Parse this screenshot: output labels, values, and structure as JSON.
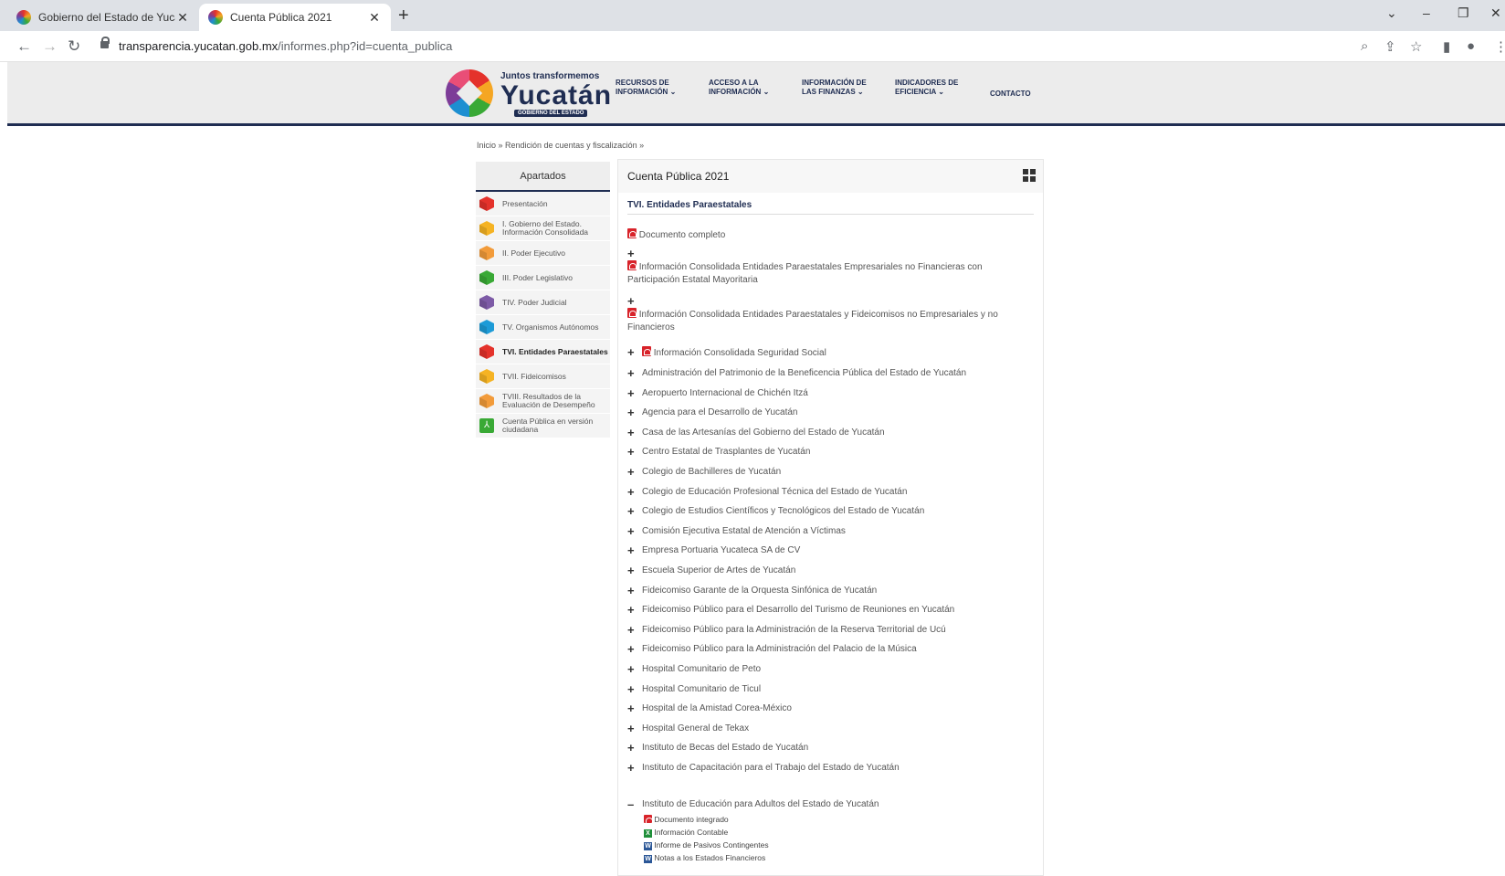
{
  "browser": {
    "tabs": [
      {
        "title": "Gobierno del Estado de Yucatán"
      },
      {
        "title": "Cuenta Pública 2021"
      }
    ],
    "url_host": "transparencia.yucatan.gob.mx",
    "url_path": "/informes.php?id=cuenta_publica"
  },
  "site": {
    "logo_tagline": "Juntos transformemos",
    "logo_name": "Yucatán",
    "logo_gov": "GOBIERNO DEL ESTADO",
    "menu": [
      {
        "line1": "RECURSOS DE",
        "line2": "INFORMACIÓN"
      },
      {
        "line1": "ACCESO A LA",
        "line2": "INFORMACIÓN"
      },
      {
        "line1": "INFORMACIÓN DE",
        "line2": "LAS FINANZAS"
      },
      {
        "line1": "INDICADORES DE",
        "line2": "EFICIENCIA"
      },
      {
        "line1": "CONTACTO",
        "line2": ""
      }
    ]
  },
  "breadcrumb": "Inicio » Rendición de cuentas y fiscalización »",
  "sidebar": {
    "heading": "Apartados",
    "items": [
      {
        "label": "Presentación",
        "color": "#e4322b"
      },
      {
        "label": "I. Gobierno del Estado. Información Consolidada",
        "color": "#f5b323"
      },
      {
        "label": "II. Poder Ejecutivo",
        "color": "#f29b3a"
      },
      {
        "label": "III. Poder Legislativo",
        "color": "#39a935"
      },
      {
        "label": "TIV. Poder Judicial",
        "color": "#7d5ba6"
      },
      {
        "label": "TV. Organismos Autónomos",
        "color": "#1d9bd7"
      },
      {
        "label": "TVI. Entidades Paraestatales",
        "color": "#e4322b"
      },
      {
        "label": "TVII. Fideicomisos",
        "color": "#f5b323"
      },
      {
        "label": "TVIII. Resultados de la Evaluación de Desempeño",
        "color": "#f29b3a"
      },
      {
        "label": "Cuenta Pública en versión ciudadana",
        "color": "#39a935"
      }
    ]
  },
  "panel": {
    "title": "Cuenta Pública 2021",
    "section": "TVI. Entidades Paraestatales",
    "doc_complete": "Documento completo",
    "cons1": "Información Consolidada Entidades Paraestatales Empresariales no Financieras con Participación Estatal Mayoritaria",
    "cons2": "Información Consolidada Entidades Paraestatales y Fideicomisos no Empresariales y no Financieros",
    "cons3": "Información Consolidada Seguridad Social",
    "entities": [
      "Administración del Patrimonio de la Beneficencia Pública del Estado de Yucatán",
      "Aeropuerto Internacional de Chichén Itzá",
      "Agencia para el Desarrollo de Yucatán",
      "Casa de las Artesanías del Gobierno del Estado de Yucatán",
      "Centro Estatal de Trasplantes de Yucatán",
      "Colegio de Bachilleres de Yucatán",
      "Colegio de Educación Profesional Técnica del Estado de Yucatán",
      "Colegio de Estudios Científicos y Tecnológicos del Estado de Yucatán",
      "Comisión Ejecutiva Estatal de Atención a Víctimas",
      "Empresa Portuaria Yucateca SA de CV",
      "Escuela Superior de Artes de Yucatán",
      "Fideicomiso Garante de la Orquesta Sinfónica de Yucatán",
      "Fideicomiso Público para el Desarrollo del Turismo de Reuniones en Yucatán",
      "Fideicomiso Público para la Administración de la Reserva Territorial de Ucú",
      "Fideicomiso Público para la Administración del Palacio de la Música",
      "Hospital Comunitario de Peto",
      "Hospital Comunitario de Ticul",
      "Hospital de la Amistad Corea-México",
      "Hospital General de Tekax",
      "Instituto de Becas del Estado de Yucatán",
      "Instituto de Capacitación para el Trabajo del Estado de Yucatán"
    ],
    "expanded": "Instituto de Educación para Adultos del Estado de Yucatán",
    "expanded_docs": [
      {
        "label": "Documento integrado",
        "type": "pdf"
      },
      {
        "label": "Información Contable",
        "type": "excel"
      },
      {
        "label": "Informe de Pasivos Contingentes",
        "type": "word"
      },
      {
        "label": "Notas a los Estados Financieros",
        "type": "word"
      }
    ]
  }
}
